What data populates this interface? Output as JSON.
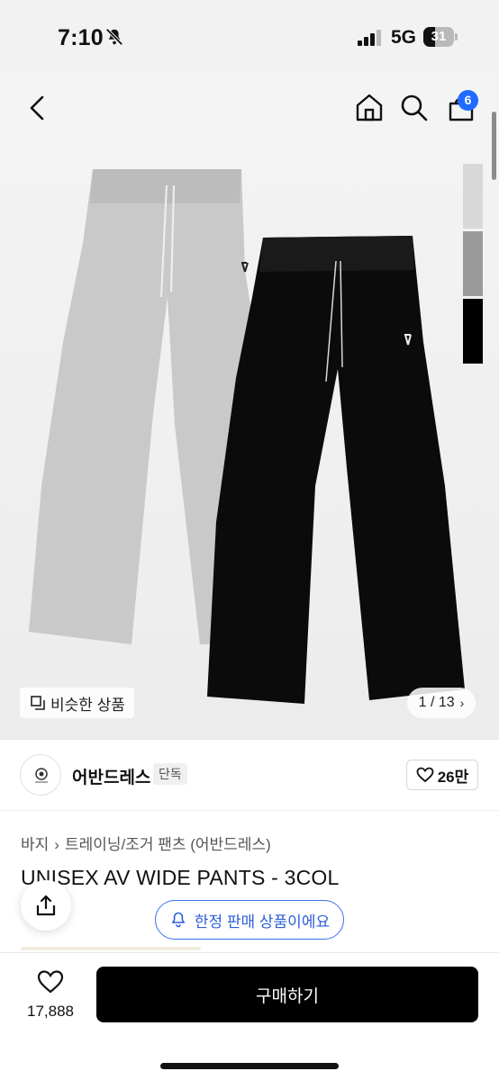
{
  "status_bar": {
    "time": "7:10",
    "network": "5G",
    "battery": "31"
  },
  "header": {
    "cart_count": "6"
  },
  "hero": {
    "swatch_colors": [
      "#d8d8d8",
      "#9a9a9a",
      "#000000"
    ],
    "similar_label": "비슷한 상품",
    "page_counter": "1 / 13"
  },
  "brand": {
    "name": "어반드레스",
    "tag": "단독",
    "likes": "26만"
  },
  "breadcrumb": [
    "바지",
    "트레이닝/조거 팬츠 (어반드레스)"
  ],
  "product": {
    "title": "UNISEX AV WIDE PANTS - 3COL"
  },
  "limited_notice": "한정 판매 상품이에요",
  "bottom_bar": {
    "wish_count": "17,888",
    "buy_label": "구매하기"
  },
  "colors": {
    "accent": "#1f6bff",
    "button": "#000000"
  }
}
